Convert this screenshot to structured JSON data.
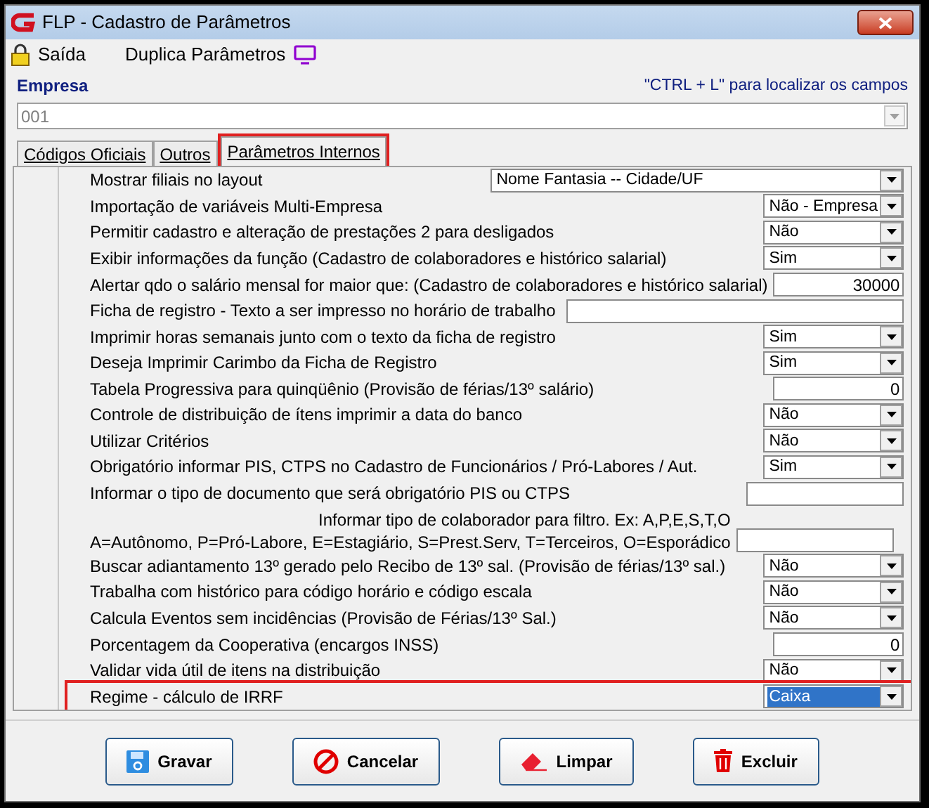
{
  "window": {
    "title": "FLP - Cadastro de Parâmetros"
  },
  "toolbar": [
    {
      "kind": "lock",
      "label": "Saída"
    },
    {
      "kind": "monitor",
      "label": "Duplica Parâmetros"
    }
  ],
  "company": {
    "label": "Empresa",
    "hint": "\"CTRL + L\" para localizar os campos",
    "value": "001"
  },
  "tabs": [
    {
      "label": "Códigos Oficiais",
      "selected": false,
      "highlighted": false
    },
    {
      "label": "Outros",
      "selected": false,
      "highlighted": false
    },
    {
      "label": "Parâmetros Internos",
      "selected": true,
      "highlighted": true
    }
  ],
  "parameters": [
    {
      "kind": "wide-select",
      "label": "Mostrar filiais no layout",
      "value": "Nome Fantasia -- Cidade/UF",
      "highlighted": false,
      "focused": false
    },
    {
      "kind": "select",
      "label": "Importação de variáveis Multi-Empresa",
      "value": "Não - Empresa",
      "highlighted": false,
      "focused": false
    },
    {
      "kind": "select",
      "label": "Permitir cadastro e alteração de prestações 2 para desligados",
      "value": "Não",
      "highlighted": false,
      "focused": false
    },
    {
      "kind": "select",
      "label": "Exibir informações da função (Cadastro de colaboradores e histórico salarial)",
      "value": "Sim",
      "highlighted": false,
      "focused": false
    },
    {
      "kind": "number",
      "label": "Alertar qdo o salário mensal for maior que: (Cadastro de colaboradores e histórico salarial)",
      "value": "30000",
      "highlighted": false,
      "focused": false
    },
    {
      "kind": "wide-text",
      "label": "Ficha de registro - Texto a ser impresso no horário de trabalho",
      "highlighted": false,
      "focused": false
    },
    {
      "kind": "select",
      "label": "Imprimir horas semanais junto com o texto da ficha de registro",
      "value": "Sim",
      "highlighted": false,
      "focused": false
    },
    {
      "kind": "select",
      "label": "Deseja Imprimir Carimbo da Ficha de Registro",
      "value": "Sim",
      "highlighted": false,
      "focused": false
    },
    {
      "kind": "number",
      "label": "Tabela Progressiva para quinqüênio (Provisão de férias/13º salário)",
      "value": "0",
      "highlighted": false,
      "focused": false
    },
    {
      "kind": "select",
      "label": "Controle de distribuição de ítens imprimir a data do banco",
      "value": "Não",
      "highlighted": false,
      "focused": false
    },
    {
      "kind": "select",
      "label": "Utilizar Critérios",
      "value": "Não",
      "highlighted": false,
      "focused": false
    },
    {
      "kind": "select",
      "label": "Obrigatório informar PIS, CTPS no Cadastro de Funcionários / Pró-Labores / Aut.",
      "value": "Sim",
      "highlighted": false,
      "focused": false
    },
    {
      "kind": "text",
      "label": "Informar o tipo de documento que será obrigatório PIS ou CTPS",
      "highlighted": false,
      "focused": false
    },
    {
      "kind": "text2",
      "label": "Informar tipo de colaborador para filtro. Ex: A,P,E,S,T,O",
      "label2": "A=Autônomo, P=Pró-Labore, E=Estagiário, S=Prest.Serv, T=Terceiros, O=Esporádico",
      "highlighted": false,
      "focused": false
    },
    {
      "kind": "select",
      "label": "Buscar adiantamento 13º  gerado pelo Recibo de 13º sal. (Provisão de férias/13º sal.)",
      "value": "Não",
      "highlighted": false,
      "focused": false
    },
    {
      "kind": "select",
      "label": "Trabalha com histórico para código horário e código escala",
      "value": "Não",
      "highlighted": false,
      "focused": false
    },
    {
      "kind": "select",
      "label": "Calcula Eventos sem incidências (Provisão de Férias/13º Sal.)",
      "value": "Não",
      "highlighted": false,
      "focused": false
    },
    {
      "kind": "number",
      "label": "Porcentagem da Cooperativa (encargos INSS)",
      "value": "0",
      "highlighted": false,
      "focused": false
    },
    {
      "kind": "select",
      "label": "Validar vida útil de itens na distribuição",
      "value": "Não",
      "highlighted": false,
      "focused": false
    },
    {
      "kind": "select",
      "label": "Regime - cálculo de IRRF",
      "value": "Caixa",
      "highlighted": true,
      "focused": true
    }
  ],
  "buttons": [
    {
      "kind": "save",
      "label": "Gravar"
    },
    {
      "kind": "cancel",
      "label": "Cancelar"
    },
    {
      "kind": "clear",
      "label": "Limpar"
    },
    {
      "kind": "delete",
      "label": "Excluir"
    }
  ]
}
